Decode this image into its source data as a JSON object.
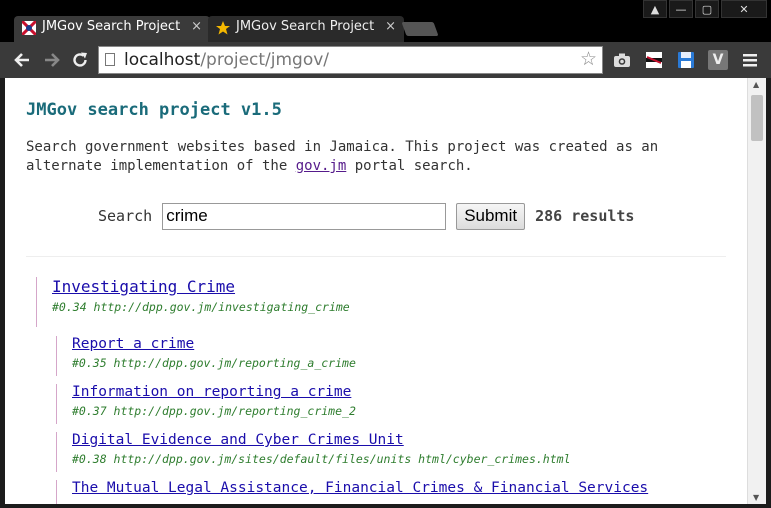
{
  "browser": {
    "tabs": [
      {
        "title": "JMGov Search Project",
        "close": "×"
      },
      {
        "title": "JMGov Search Project",
        "close": "×"
      }
    ],
    "url_host": "localhost",
    "url_path": "/project/jmgov/",
    "window_controls": {
      "user": "▲",
      "minimize": "—",
      "maximize": "▢",
      "close": "✕"
    },
    "extension_v_label": "V"
  },
  "page": {
    "title": "JMGov search project v1.5",
    "intro_before": "Search government websites based in Jamaica. This project was created as an alternate implementation of the ",
    "intro_link": "gov.jm",
    "intro_after": " portal search.",
    "search_label": "Search",
    "search_value": "crime",
    "submit_label": "Submit",
    "results_count": "286 results"
  },
  "results": [
    {
      "title": "Investigating Crime",
      "meta": "#0.34 http://dpp.gov.jm/investigating_crime",
      "level": "top"
    },
    {
      "title": "Report a crime",
      "meta": "#0.35 http://dpp.gov.jm/reporting_a_crime",
      "level": "sub"
    },
    {
      "title": "Information on reporting a crime",
      "meta": "#0.37 http://dpp.gov.jm/reporting_crime_2",
      "level": "sub"
    },
    {
      "title": "Digital Evidence and Cyber Crimes Unit",
      "meta": "#0.38 http://dpp.gov.jm/sites/default/files/units html/cyber_crimes.html",
      "level": "sub"
    },
    {
      "title": "The Mutual Legal Assistance, Financial Crimes & Financial Services",
      "meta": "",
      "level": "sub"
    }
  ],
  "icons": {
    "back": "back-arrow-icon",
    "forward": "forward-arrow-icon",
    "reload": "reload-icon",
    "page": "page-icon",
    "star": "bookmark-star-icon",
    "camera": "camera-icon",
    "mask": "incognito-icon",
    "save": "floppy-icon",
    "menu": "hamburger-menu-icon"
  },
  "colors": {
    "heading": "#1a6b7a",
    "link": "#1a0dab",
    "visited_link": "#551a8b",
    "meta": "#2e7d2e",
    "result_border": "#d5a6c9"
  }
}
